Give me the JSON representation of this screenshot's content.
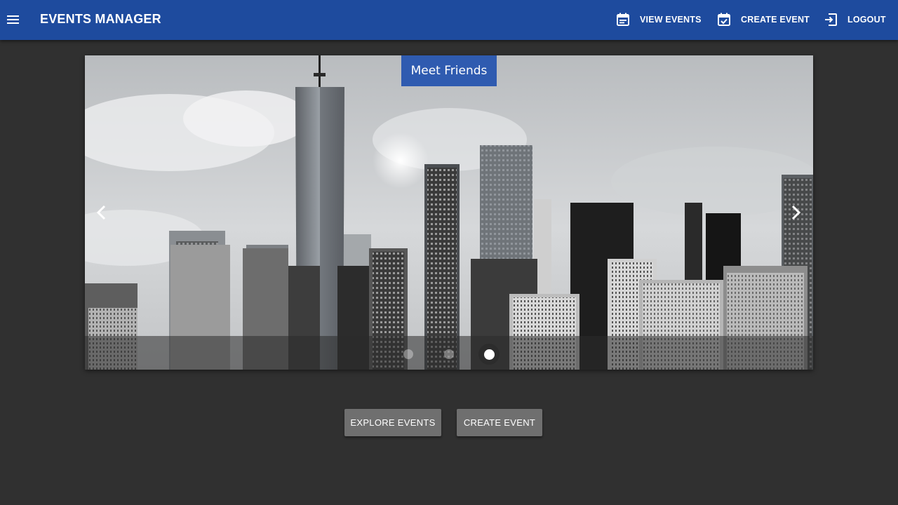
{
  "app": {
    "title": "EVENTS MANAGER"
  },
  "toolbar": {
    "menu_icon": "menu-icon",
    "nav": [
      {
        "label": "VIEW EVENTS",
        "icon": "calendar-event-icon"
      },
      {
        "label": "CREATE EVENT",
        "icon": "calendar-check-icon"
      },
      {
        "label": "LOGOUT",
        "icon": "logout-icon"
      }
    ]
  },
  "carousel": {
    "caption": "Meet Friends",
    "slide_count": 3,
    "active_slide": 3,
    "prev_icon": "chevron-left-icon",
    "next_icon": "chevron-right-icon"
  },
  "actions": {
    "explore_label": "EXPLORE EVENTS",
    "create_label": "CREATE EVENT"
  },
  "colors": {
    "toolbar": "#1e4b9e",
    "background": "#303030",
    "caption_bg": "#2f5bb0",
    "button_bg": "#6f6f6f"
  }
}
